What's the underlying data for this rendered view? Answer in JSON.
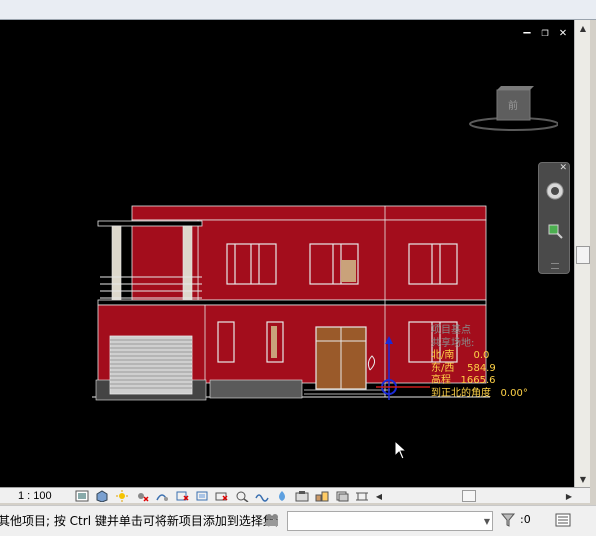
{
  "viewport": {
    "window_controls": [
      "minimize-icon",
      "restore-icon",
      "close-icon"
    ],
    "view_cube": {
      "face_label": "前"
    },
    "nav_bar": {
      "items": [
        "steering-wheel-icon",
        "zoom-region-icon"
      ]
    },
    "project_base_point": {
      "header_lines": [
        "项目基点",
        "共享场地:"
      ],
      "rows": [
        {
          "key": "北/南",
          "value": "0.0"
        },
        {
          "key": "东/西",
          "value": "584.9"
        },
        {
          "key": "高程",
          "value": "1665.6"
        },
        {
          "key": "到正北的角度",
          "value": "0.00°"
        }
      ]
    },
    "colors": {
      "background": "#000000",
      "wall": "#a30d1c",
      "outline": "#e8e8e8",
      "door": "#9a5a2a",
      "label": "#ffd247"
    }
  },
  "view_control_bar": {
    "scale": "1 : 100",
    "icons": [
      "detail-level-icon",
      "visual-style-icon",
      "sun-path-icon",
      "shadows-off-icon",
      "render-icon",
      "crop-view-icon",
      "show-crop-icon",
      "temporary-hide-icon",
      "reveal-hidden-icon",
      "analysis-icon",
      "highlight-icon",
      "temporary-view-icon",
      "worksets-icon",
      "design-options-icon",
      "constraints-icon"
    ]
  },
  "status_bar": {
    "message": "其他项目; 按 Ctrl 键并单击可将新项目添加到选择集;",
    "selection_count": ":0",
    "icons": [
      "worksharing-monitor-icon",
      "filter-icon",
      "properties-icon"
    ]
  }
}
